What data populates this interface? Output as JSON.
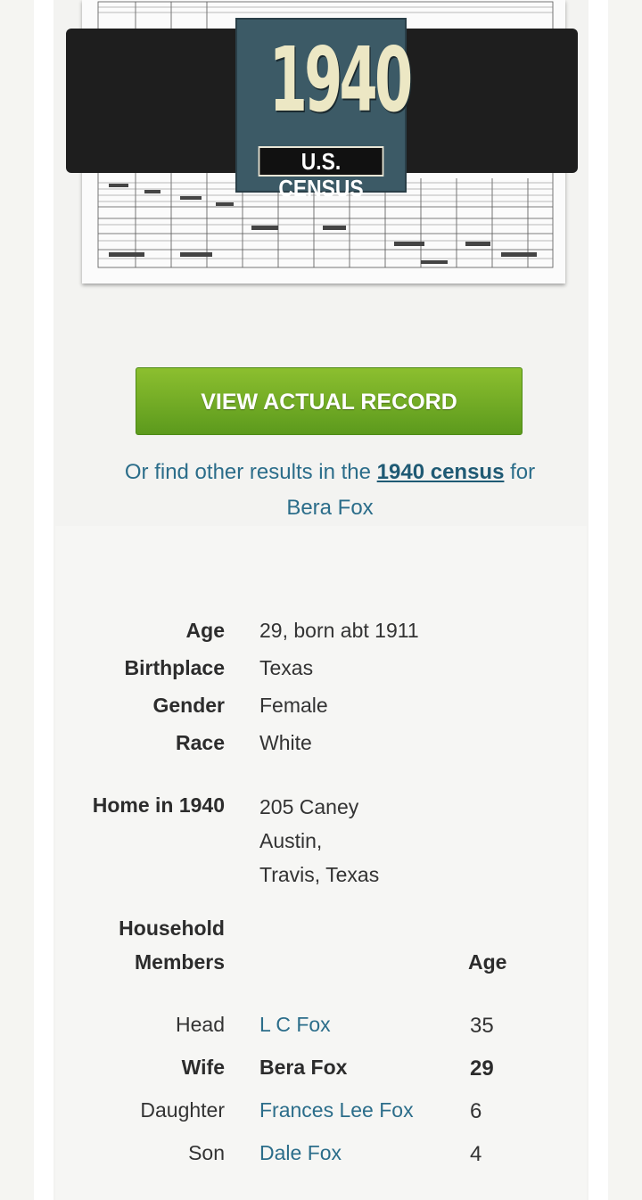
{
  "badge": {
    "year": "1940",
    "label": "U.S. CENSUS"
  },
  "actions": {
    "view_record_label": "VIEW ACTUAL RECORD",
    "find_other_prefix": "Or find other results in the ",
    "find_other_link": "1940 census",
    "find_other_suffix": " for",
    "find_other_name": "Bera Fox"
  },
  "person": {
    "age_label": "Age",
    "age_value": "29, born abt 1911",
    "birthplace_label": "Birthplace",
    "birthplace_value": "Texas",
    "gender_label": "Gender",
    "gender_value": "Female",
    "race_label": "Race",
    "race_value": "White",
    "home_label": "Home in 1940",
    "home_lines": [
      "205 Caney",
      "Austin,",
      "Travis, Texas"
    ]
  },
  "household": {
    "label_line1": "Household",
    "label_line2": "Members",
    "age_header": "Age",
    "members": [
      {
        "relation": "Head",
        "name": "L C Fox",
        "age": "35",
        "is_self": false
      },
      {
        "relation": "Wife",
        "name": "Bera Fox",
        "age": "29",
        "is_self": true
      },
      {
        "relation": "Daughter",
        "name": "Frances Lee Fox",
        "age": "6",
        "is_self": false
      },
      {
        "relation": "Son",
        "name": "Dale Fox",
        "age": "4",
        "is_self": false
      }
    ]
  },
  "colors": {
    "button_green": "#6aa823",
    "link_blue": "#2b6d8a",
    "badge_teal": "#3c5a66"
  }
}
